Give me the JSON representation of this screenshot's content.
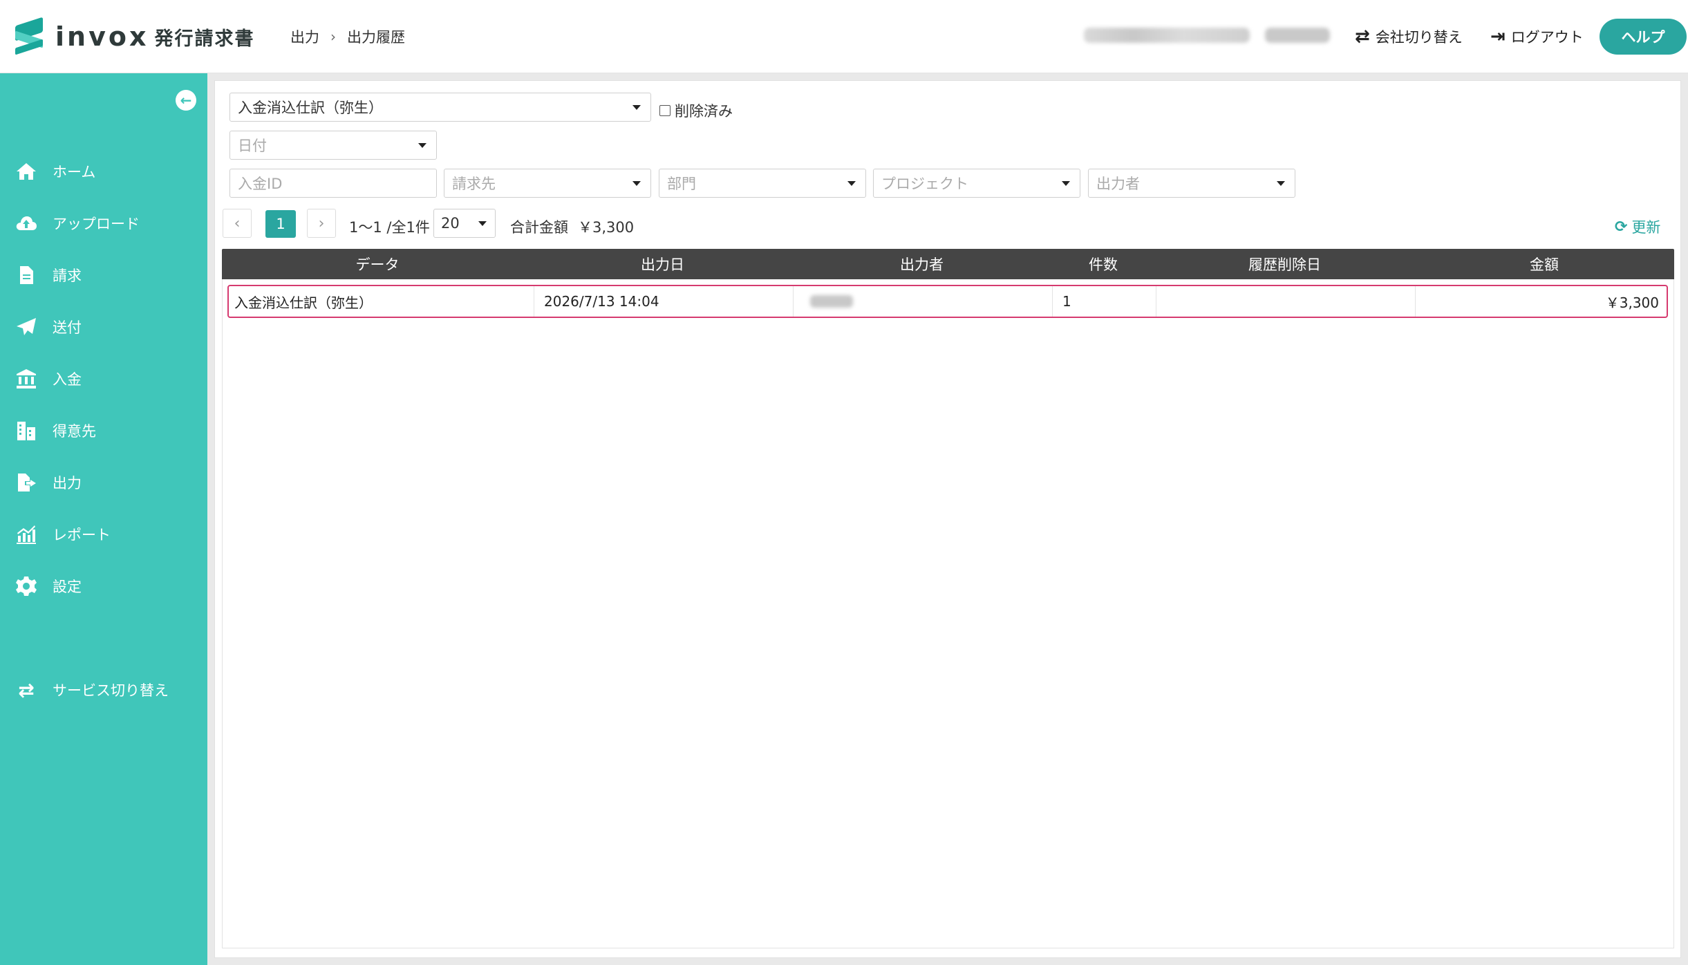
{
  "app": {
    "logo_word": "invox",
    "logo_sub": "発行請求書"
  },
  "breadcrumb": {
    "parent": "出力",
    "separator": "›",
    "current": "出力履歴"
  },
  "header": {
    "switch_company": "会社切り替え",
    "logout": "ログアウト",
    "help": "ヘルプ"
  },
  "sidebar": {
    "items": [
      {
        "label": "ホーム",
        "icon": "home-icon"
      },
      {
        "label": "アップロード",
        "icon": "cloud-upload-icon"
      },
      {
        "label": "請求",
        "icon": "document-icon"
      },
      {
        "label": "送付",
        "icon": "paper-plane-icon"
      },
      {
        "label": "入金",
        "icon": "bank-icon"
      },
      {
        "label": "得意先",
        "icon": "building-icon"
      },
      {
        "label": "出力",
        "icon": "file-export-icon"
      },
      {
        "label": "レポート",
        "icon": "chart-icon"
      },
      {
        "label": "設定",
        "icon": "gear-icon"
      }
    ],
    "service_switch": "サービス切り替え"
  },
  "filters": {
    "data_type": "入金消込仕訳（弥生）",
    "deleted_label": "削除済み",
    "date_placeholder": "日付",
    "payment_id_placeholder": "入金ID",
    "client_placeholder": "請求先",
    "department_placeholder": "部門",
    "project_placeholder": "プロジェクト",
    "exporter_placeholder": "出力者"
  },
  "pagination": {
    "prev": "‹",
    "current_page": "1",
    "next": "›",
    "range": "1〜1 /全1件",
    "per_page": "20",
    "total_label": "合計金額",
    "total_value": "￥3,300",
    "refresh": "更新"
  },
  "table": {
    "columns": [
      "データ",
      "出力日",
      "出力者",
      "件数",
      "履歴削除日",
      "金額"
    ],
    "rows": [
      {
        "data": "入金消込仕訳（弥生）",
        "date": "2026/7/13 14:04",
        "count": "1",
        "deleted_date": "",
        "amount": "￥3,300"
      }
    ]
  },
  "colors": {
    "teal": "#40c6ba",
    "accent": "#2aa6a0",
    "highlight": "#d63a6f",
    "header_dark": "#454545"
  }
}
